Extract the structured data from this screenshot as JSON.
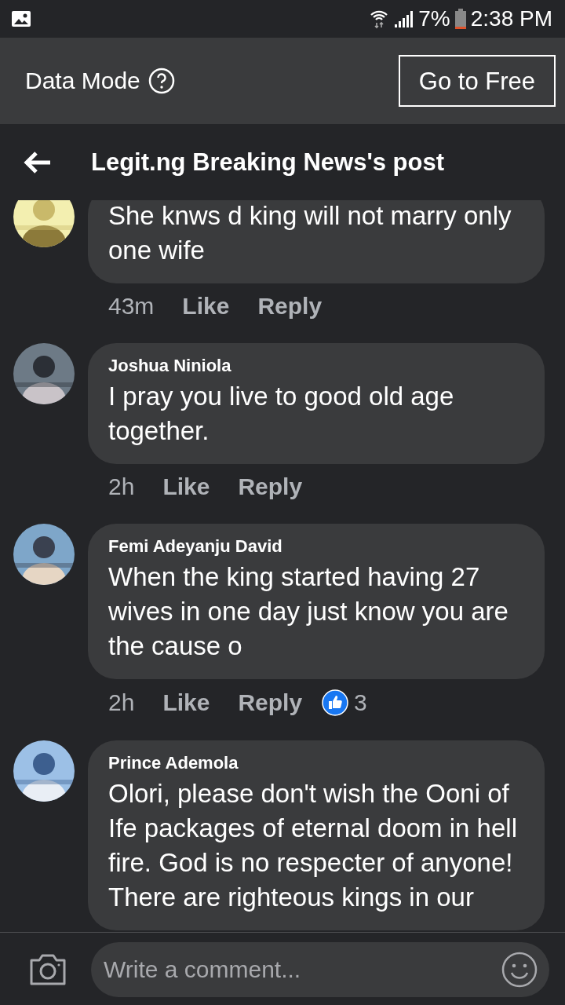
{
  "status_bar": {
    "battery": "7%",
    "time": "2:38 PM"
  },
  "data_mode": {
    "label": "Data Mode",
    "button": "Go to Free"
  },
  "header": {
    "title": "Legit.ng Breaking News's post"
  },
  "comments": [
    {
      "text": "She knws d king will not marry only one wife",
      "time": "43m",
      "like": "Like",
      "reply": "Reply"
    },
    {
      "author": "Joshua Niniola",
      "text": "I pray you live to good old age together.",
      "time": "2h",
      "like": "Like",
      "reply": "Reply"
    },
    {
      "author": "Femi Adeyanju David",
      "text": "When the king started having 27 wives in one day just know you are the cause o",
      "time": "2h",
      "like": "Like",
      "reply": "Reply",
      "reactions": "3"
    },
    {
      "author": "Prince Ademola",
      "text": "Olori, please don't wish the Ooni of Ife packages of eternal doom in hell fire. God is no respecter of anyone! There are righteous kings in our"
    }
  ],
  "composer": {
    "placeholder": "Write a comment..."
  }
}
